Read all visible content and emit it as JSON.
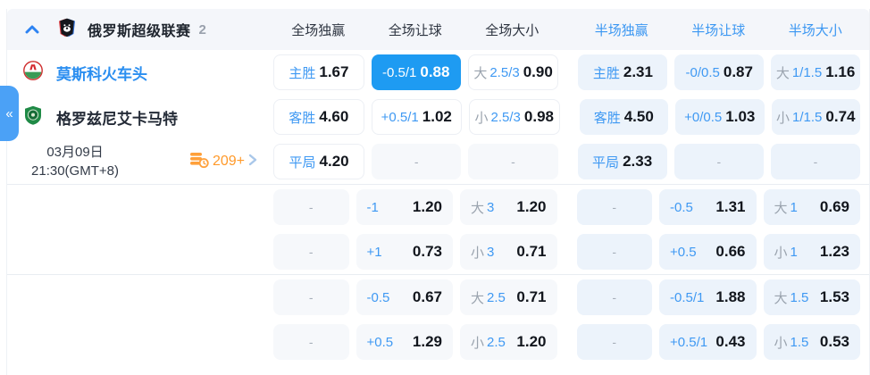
{
  "header": {
    "league_title": "俄罗斯超级联赛",
    "match_count": "2",
    "columns": [
      {
        "label": "全场独赢"
      },
      {
        "label": "全场让球"
      },
      {
        "label": "全场大小"
      },
      {
        "label": "半场独赢"
      },
      {
        "label": "半场让球"
      },
      {
        "label": "半场大小"
      }
    ]
  },
  "match": {
    "home_team": "莫斯科火车头",
    "away_team": "格罗兹尼艾卡马特",
    "date": "03月09日",
    "time": "21:30(GMT+8)",
    "markets_count": "209+"
  },
  "collapse_tab_glyph": "«",
  "colors": {
    "accent_blue": "#3f99f3",
    "selected_bg": "#1e9bf2",
    "orange": "#ff9a2b"
  },
  "grid": {
    "sections": [
      {
        "rows": [
          [
            {
              "h": "主胜",
              "v": "1.67",
              "kind": "plain"
            },
            {
              "h": "-0.5/1",
              "v": "0.88",
              "kind": "selected"
            },
            {
              "p": "大",
              "h": "2.5/3",
              "v": "0.90",
              "kind": "plain"
            },
            {
              "h": "主胜",
              "v": "2.31",
              "kind": "half"
            },
            {
              "h": "-0/0.5",
              "v": "0.87",
              "kind": "half"
            },
            {
              "p": "大",
              "h": "1/1.5",
              "v": "1.16",
              "kind": "half"
            }
          ],
          [
            {
              "h": "客胜",
              "v": "4.60",
              "kind": "plain"
            },
            {
              "h": "+0.5/1",
              "v": "1.02",
              "kind": "plain"
            },
            {
              "p": "小",
              "h": "2.5/3",
              "v": "0.98",
              "kind": "plain"
            },
            {
              "h": "客胜",
              "v": "4.50",
              "kind": "half"
            },
            {
              "h": "+0/0.5",
              "v": "1.03",
              "kind": "half"
            },
            {
              "p": "小",
              "h": "1/1.5",
              "v": "0.74",
              "kind": "half"
            }
          ],
          [
            {
              "h": "平局",
              "v": "4.20",
              "kind": "plain"
            },
            {
              "d": "-",
              "kind": "muted"
            },
            {
              "d": "-",
              "kind": "muted"
            },
            {
              "h": "平局",
              "v": "2.33",
              "kind": "half"
            },
            {
              "d": "-",
              "kind": "half"
            },
            {
              "d": "-",
              "kind": "half"
            }
          ]
        ]
      },
      {
        "rows": [
          [
            {
              "d": "-",
              "kind": "muted"
            },
            {
              "h": "-1",
              "v": "1.20",
              "kind": "muted"
            },
            {
              "p": "大",
              "h": "3",
              "v": "1.20",
              "kind": "muted"
            },
            {
              "d": "-",
              "kind": "half"
            },
            {
              "h": "-0.5",
              "v": "1.31",
              "kind": "half"
            },
            {
              "p": "大",
              "h": "1",
              "v": "0.69",
              "kind": "half"
            }
          ],
          [
            {
              "d": "-",
              "kind": "muted"
            },
            {
              "h": "+1",
              "v": "0.73",
              "kind": "muted"
            },
            {
              "p": "小",
              "h": "3",
              "v": "0.71",
              "kind": "muted"
            },
            {
              "d": "-",
              "kind": "half"
            },
            {
              "h": "+0.5",
              "v": "0.66",
              "kind": "half"
            },
            {
              "p": "小",
              "h": "1",
              "v": "1.23",
              "kind": "half"
            }
          ]
        ]
      },
      {
        "rows": [
          [
            {
              "d": "-",
              "kind": "muted"
            },
            {
              "h": "-0.5",
              "v": "0.67",
              "kind": "muted"
            },
            {
              "p": "大",
              "h": "2.5",
              "v": "0.71",
              "kind": "muted"
            },
            {
              "d": "-",
              "kind": "half"
            },
            {
              "h": "-0.5/1",
              "v": "1.88",
              "kind": "half"
            },
            {
              "p": "大",
              "h": "1.5",
              "v": "1.53",
              "kind": "half"
            }
          ],
          [
            {
              "d": "-",
              "kind": "muted"
            },
            {
              "h": "+0.5",
              "v": "1.29",
              "kind": "muted"
            },
            {
              "p": "小",
              "h": "2.5",
              "v": "1.20",
              "kind": "muted"
            },
            {
              "d": "-",
              "kind": "half"
            },
            {
              "h": "+0.5/1",
              "v": "0.43",
              "kind": "half"
            },
            {
              "p": "小",
              "h": "1.5",
              "v": "0.53",
              "kind": "half"
            }
          ]
        ]
      }
    ]
  }
}
